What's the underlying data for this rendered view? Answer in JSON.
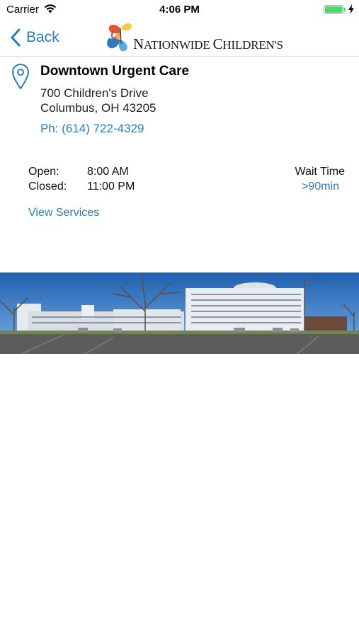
{
  "status_bar": {
    "carrier": "Carrier",
    "time": "4:06 PM",
    "battery_level_percent": 100,
    "charging": true,
    "battery_color": "#4cd964"
  },
  "nav": {
    "back_label": "Back",
    "logo_text_first": "N",
    "logo_text_rest1": "ATIONWIDE ",
    "logo_text_cap2": "C",
    "logo_text_rest2": "HILDREN'S",
    "accent_color": "#2e7ab8"
  },
  "location": {
    "name": "Downtown Urgent Care",
    "address_line1": "700 Children's Drive",
    "address_line2": "Columbus, OH 43205",
    "phone": "Ph: (614) 722-4329",
    "open_label": "Open:",
    "open_time": "8:00 AM",
    "closed_label": "Closed:",
    "closed_time": "11:00 PM",
    "wait_label": "Wait Time",
    "wait_value": ">90min",
    "view_services_label": "View Services"
  },
  "icons": {
    "back": "chevron-left-icon",
    "pin": "map-pin-icon",
    "wifi": "wifi-icon",
    "battery": "battery-icon",
    "charging": "lightning-bolt-icon"
  }
}
